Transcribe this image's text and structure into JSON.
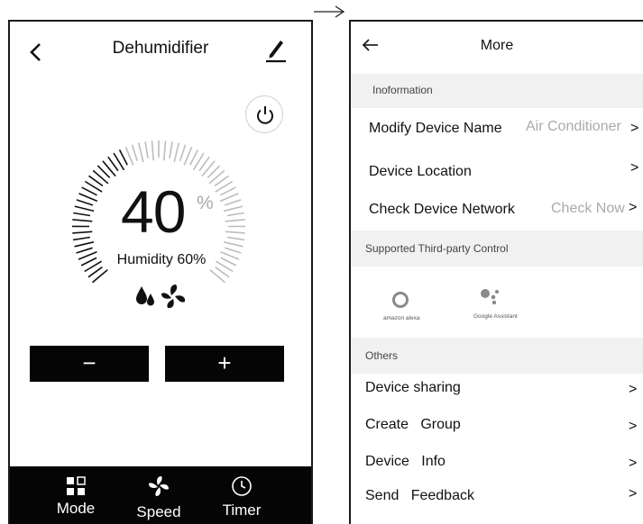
{
  "left": {
    "title": "Dehumidifier",
    "value": "40",
    "unit": "%",
    "humidity_label": "Humidity 60%",
    "minus_label": "−",
    "plus_label": "+",
    "tabs": [
      {
        "label": "Mode",
        "icon": "mode-icon"
      },
      {
        "label": "Speed",
        "icon": "fan-icon"
      },
      {
        "label": "Timer",
        "icon": "clock-icon"
      }
    ]
  },
  "right": {
    "title": "More",
    "sections": {
      "information": "Inoformation",
      "third_party": "Supported  Third-party  Control",
      "others": "Others"
    },
    "info_rows": [
      {
        "label": "Modify Device Name",
        "value": "Air Conditioner",
        "chevron": ">"
      },
      {
        "label": "Device Location",
        "value": "",
        "chevron": ">"
      },
      {
        "label": "Check Device Network",
        "value": "Check Now",
        "chevron": ">"
      }
    ],
    "third_party_items": [
      {
        "label": "amazon alexa",
        "icon": "alexa-icon"
      },
      {
        "label": "Google Assistant",
        "icon": "google-assistant-icon"
      }
    ],
    "other_rows": [
      {
        "label": "Device sharing",
        "chevron": ">"
      },
      {
        "label": "Create   Group",
        "chevron": ">"
      },
      {
        "label": "Device   Info",
        "chevron": ">"
      },
      {
        "label": "Send   Feedback",
        "chevron": ">"
      }
    ]
  },
  "colors": {
    "bar_black": "#050505",
    "section_gray": "#f1f1f1",
    "muted_text": "#aaaaaa"
  }
}
